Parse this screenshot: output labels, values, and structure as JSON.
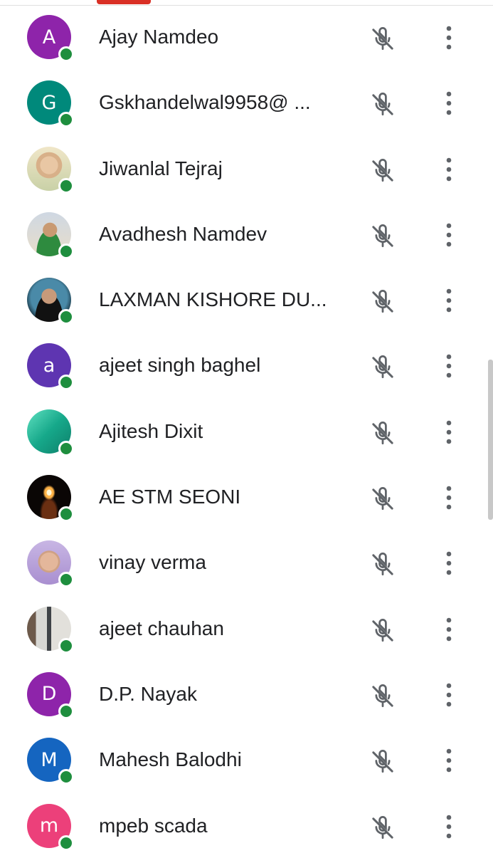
{
  "theme": {
    "presence_color": "#1e8e3e",
    "accent": "#d93025"
  },
  "icons": {
    "mic": "mic-off-icon",
    "more": "more-vert-icon"
  },
  "participants": [
    {
      "name": "Ajay Namdeo",
      "avatar_letter": "A",
      "avatar_color": "#8e24aa",
      "avatar_kind": "letter"
    },
    {
      "name": "Gskhandelwal9958@ ...",
      "avatar_letter": "G",
      "avatar_color": "#00897b",
      "avatar_kind": "letter"
    },
    {
      "name": "Jiwanlal Tejraj",
      "avatar_letter": "",
      "avatar_color": "#e8d9b0",
      "avatar_kind": "photo-glasses"
    },
    {
      "name": "Avadhesh Namdev",
      "avatar_letter": "",
      "avatar_color": "#d9dee6",
      "avatar_kind": "photo-green"
    },
    {
      "name": "LAXMAN KISHORE DU...",
      "avatar_letter": "",
      "avatar_color": "#1f3b4d",
      "avatar_kind": "photo-dark"
    },
    {
      "name": "ajeet singh baghel",
      "avatar_letter": "a",
      "avatar_color": "#5e35b1",
      "avatar_kind": "letter"
    },
    {
      "name": "Ajitesh Dixit",
      "avatar_letter": "",
      "avatar_color": "#1fb89a",
      "avatar_kind": "photo-teal"
    },
    {
      "name": "AE STM SEONI",
      "avatar_letter": "",
      "avatar_color": "#0a0605",
      "avatar_kind": "photo-candle"
    },
    {
      "name": "vinay verma",
      "avatar_letter": "",
      "avatar_color": "#b9a3d6",
      "avatar_kind": "photo-lilac"
    },
    {
      "name": "ajeet chauhan",
      "avatar_letter": "",
      "avatar_color": "#8a8f95",
      "avatar_kind": "photo-room"
    },
    {
      "name": "D.P. Nayak",
      "avatar_letter": "D",
      "avatar_color": "#8e24aa",
      "avatar_kind": "letter"
    },
    {
      "name": "Mahesh Balodhi",
      "avatar_letter": "M",
      "avatar_color": "#1565c0",
      "avatar_kind": "letter"
    },
    {
      "name": "mpeb scada",
      "avatar_letter": "m",
      "avatar_color": "#ec407a",
      "avatar_kind": "letter"
    }
  ]
}
